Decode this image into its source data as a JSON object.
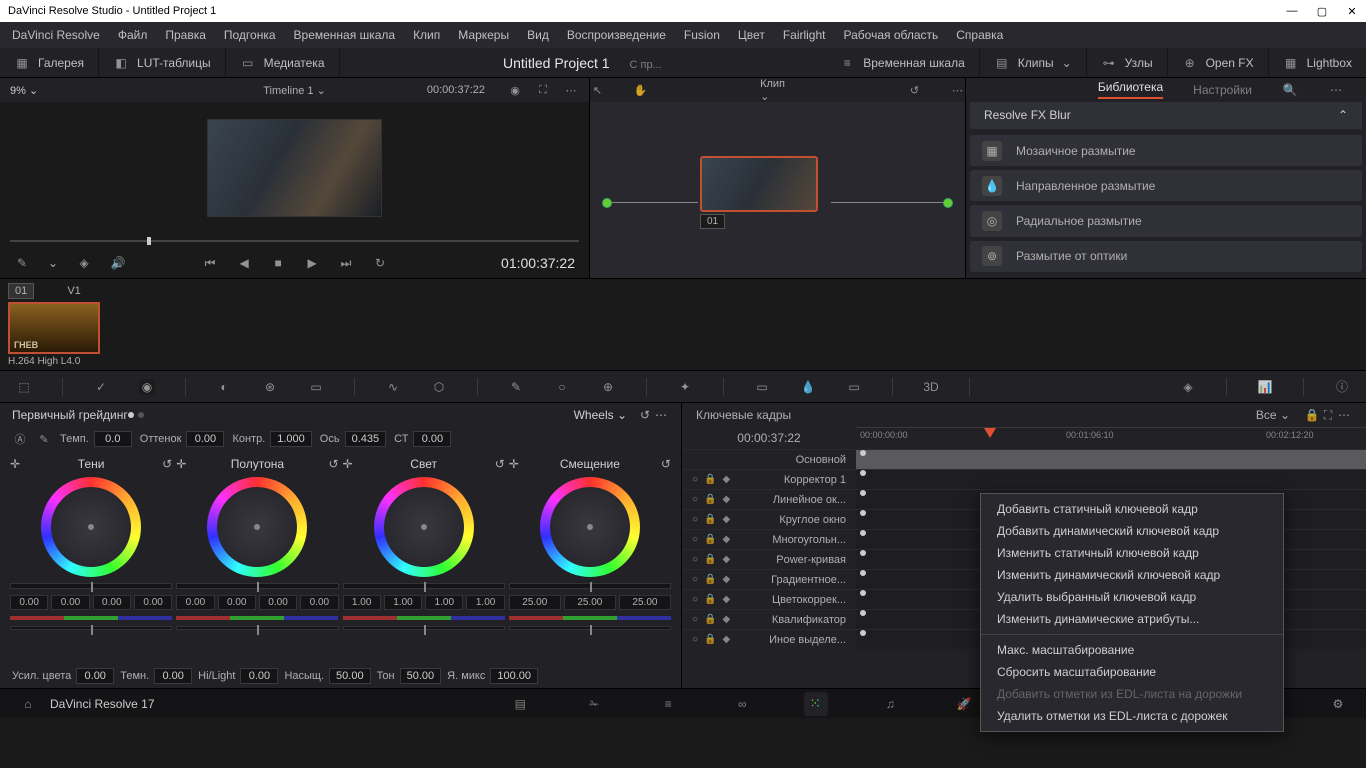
{
  "window": {
    "title": "DaVinci Resolve Studio - Untitled Project 1"
  },
  "menu": [
    "DaVinci Resolve",
    "Файл",
    "Правка",
    "Подгонка",
    "Временная шкала",
    "Клип",
    "Маркеры",
    "Вид",
    "Воспроизведение",
    "Fusion",
    "Цвет",
    "Fairlight",
    "Рабочая область",
    "Справка"
  ],
  "toolbar": {
    "gallery": "Галерея",
    "luts": "LUT-таблицы",
    "media": "Медиатека",
    "project": "Untitled Project 1",
    "timeline_label": "Временная шкала",
    "clips": "Клипы",
    "nodes": "Узлы",
    "openfx": "Open FX",
    "lightbox": "Lightbox",
    "overlay": "С пр..."
  },
  "viewer": {
    "zoom": "9%",
    "timeline": "Timeline 1",
    "timecode_in": "00:00:37:22",
    "timecode_out": "01:00:37:22"
  },
  "nodegraph": {
    "header_left": "Клип",
    "node_label": "01"
  },
  "library": {
    "tab_active": "Библиотека",
    "tab_settings": "Настройки",
    "category": "Resolve FX Blur",
    "items": [
      "Мозаичное размытие",
      "Направленное размытие",
      "Радиальное размытие",
      "Размытие от оптики"
    ]
  },
  "clip": {
    "num": "01",
    "track": "V1",
    "name": "ГНЕВ",
    "codec": "H.264 High L4.0"
  },
  "wheels": {
    "title": "Первичный грейдинг",
    "mode": "Wheels",
    "params": {
      "temp_l": "Темп.",
      "temp": "0.0",
      "tint_l": "Оттенок",
      "tint": "0.00",
      "contrast_l": "Контр.",
      "contrast": "1.000",
      "pivot_l": "Ось",
      "pivot": "0.435",
      "ct_l": "СТ",
      "ct": "0.00"
    },
    "cols": [
      {
        "name": "Тени",
        "vals": [
          "0.00",
          "0.00",
          "0.00",
          "0.00"
        ]
      },
      {
        "name": "Полутона",
        "vals": [
          "0.00",
          "0.00",
          "0.00",
          "0.00"
        ]
      },
      {
        "name": "Свет",
        "vals": [
          "1.00",
          "1.00",
          "1.00",
          "1.00"
        ]
      },
      {
        "name": "Смещение",
        "vals": [
          "25.00",
          "25.00",
          "25.00"
        ]
      }
    ],
    "footer": {
      "gain_l": "Усил. цвета",
      "gain": "0.00",
      "dark_l": "Темн.",
      "dark": "0.00",
      "hl_l": "Hi/Light",
      "hl": "0.00",
      "sat_l": "Насыщ.",
      "sat": "50.00",
      "hue_l": "Тон",
      "hue": "50.00",
      "mix_l": "Я. микс",
      "mix": "100.00"
    }
  },
  "keyframes": {
    "title": "Ключевые кадры",
    "all": "Все",
    "cur_tc": "00:00:37:22",
    "ticks": [
      "00:00:00:00",
      "00:01:06:10",
      "00:02:12:20"
    ],
    "tracks": [
      "Основной",
      "Корректор 1",
      "Линейное ок...",
      "Круглое окно",
      "Многоугольн...",
      "Power-кривая",
      "Градиентное...",
      "Цветокоррек...",
      "Квалификатор",
      "Иное выделе..."
    ]
  },
  "context_menu": [
    "Добавить статичный ключевой кадр",
    "Добавить динамический ключевой кадр",
    "Изменить статичный ключевой кадр",
    "Изменить динамический ключевой кадр",
    "Удалить выбранный ключевой кадр",
    "Изменить динамические атрибуты...",
    "---",
    "Макс. масштабирование",
    "Сбросить масштабирование",
    "---disabled:Добавить отметки из EDL-листа на дорожки",
    "Удалить отметки из EDL-листа с дорожек"
  ],
  "app_name": "DaVinci Resolve 17"
}
